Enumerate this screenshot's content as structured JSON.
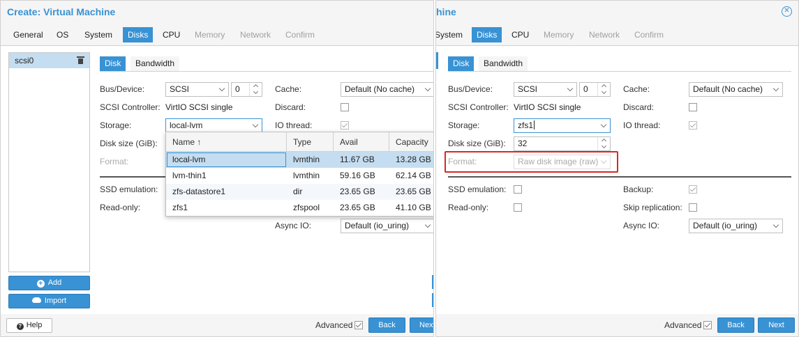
{
  "left": {
    "title": "Create: Virtual Machine",
    "tabs": [
      "General",
      "OS",
      "System",
      "Disks",
      "CPU",
      "Memory",
      "Network",
      "Confirm"
    ],
    "disk_list": [
      "scsi0"
    ],
    "add_label": "Add",
    "import_label": "Import",
    "subtabs": [
      "Disk",
      "Bandwidth"
    ],
    "labels": {
      "bus": "Bus/Device:",
      "controller": "SCSI Controller:",
      "storage": "Storage:",
      "disk_size": "Disk size (GiB):",
      "format": "Format:",
      "ssd": "SSD emulation:",
      "readonly": "Read-only:",
      "cache": "Cache:",
      "discard": "Discard:",
      "iothread": "IO thread:",
      "async": "Async IO:"
    },
    "values": {
      "bus": "SCSI",
      "device_index": "0",
      "controller": "VirtIO SCSI single",
      "storage": "local-lvm",
      "cache": "Default (No cache)",
      "async": "Default (io_uring)"
    },
    "storage_popup": {
      "headers": [
        "Name ↑",
        "Type",
        "Avail",
        "Capacity"
      ],
      "rows": [
        [
          "local-lvm",
          "lvmthin",
          "11.67 GB",
          "13.28 GB"
        ],
        [
          "lvm-thin1",
          "lvmthin",
          "59.16 GB",
          "62.14 GB"
        ],
        [
          "zfs-datastore1",
          "dir",
          "23.65 GB",
          "23.65 GB"
        ],
        [
          "zfs1",
          "zfspool",
          "23.65 GB",
          "41.10 GB"
        ]
      ]
    },
    "footer": {
      "help": "Help",
      "advanced": "Advanced",
      "back": "Back",
      "next": "Next"
    }
  },
  "right": {
    "title": "hine",
    "tabs": [
      "System",
      "Disks",
      "CPU",
      "Memory",
      "Network",
      "Confirm"
    ],
    "subtabs": [
      "Disk",
      "Bandwidth"
    ],
    "labels": {
      "bus": "Bus/Device:",
      "controller": "SCSI Controller:",
      "storage": "Storage:",
      "disk_size": "Disk size (GiB):",
      "format": "Format:",
      "ssd": "SSD emulation:",
      "readonly": "Read-only:",
      "cache": "Cache:",
      "discard": "Discard:",
      "iothread": "IO thread:",
      "backup": "Backup:",
      "skip_rep": "Skip replication:",
      "async": "Async IO:"
    },
    "values": {
      "bus": "SCSI",
      "device_index": "0",
      "controller": "VirtIO SCSI single",
      "storage": "zfs1",
      "disk_size": "32",
      "format": "Raw disk image (raw)",
      "cache": "Default (No cache)",
      "async": "Default (io_uring)"
    },
    "footer": {
      "advanced": "Advanced",
      "back": "Back",
      "next": "Next"
    }
  },
  "colors": {
    "accent": "#3892d4",
    "highlight_box": "#d92626",
    "selected_row": "#c5ddf0"
  }
}
